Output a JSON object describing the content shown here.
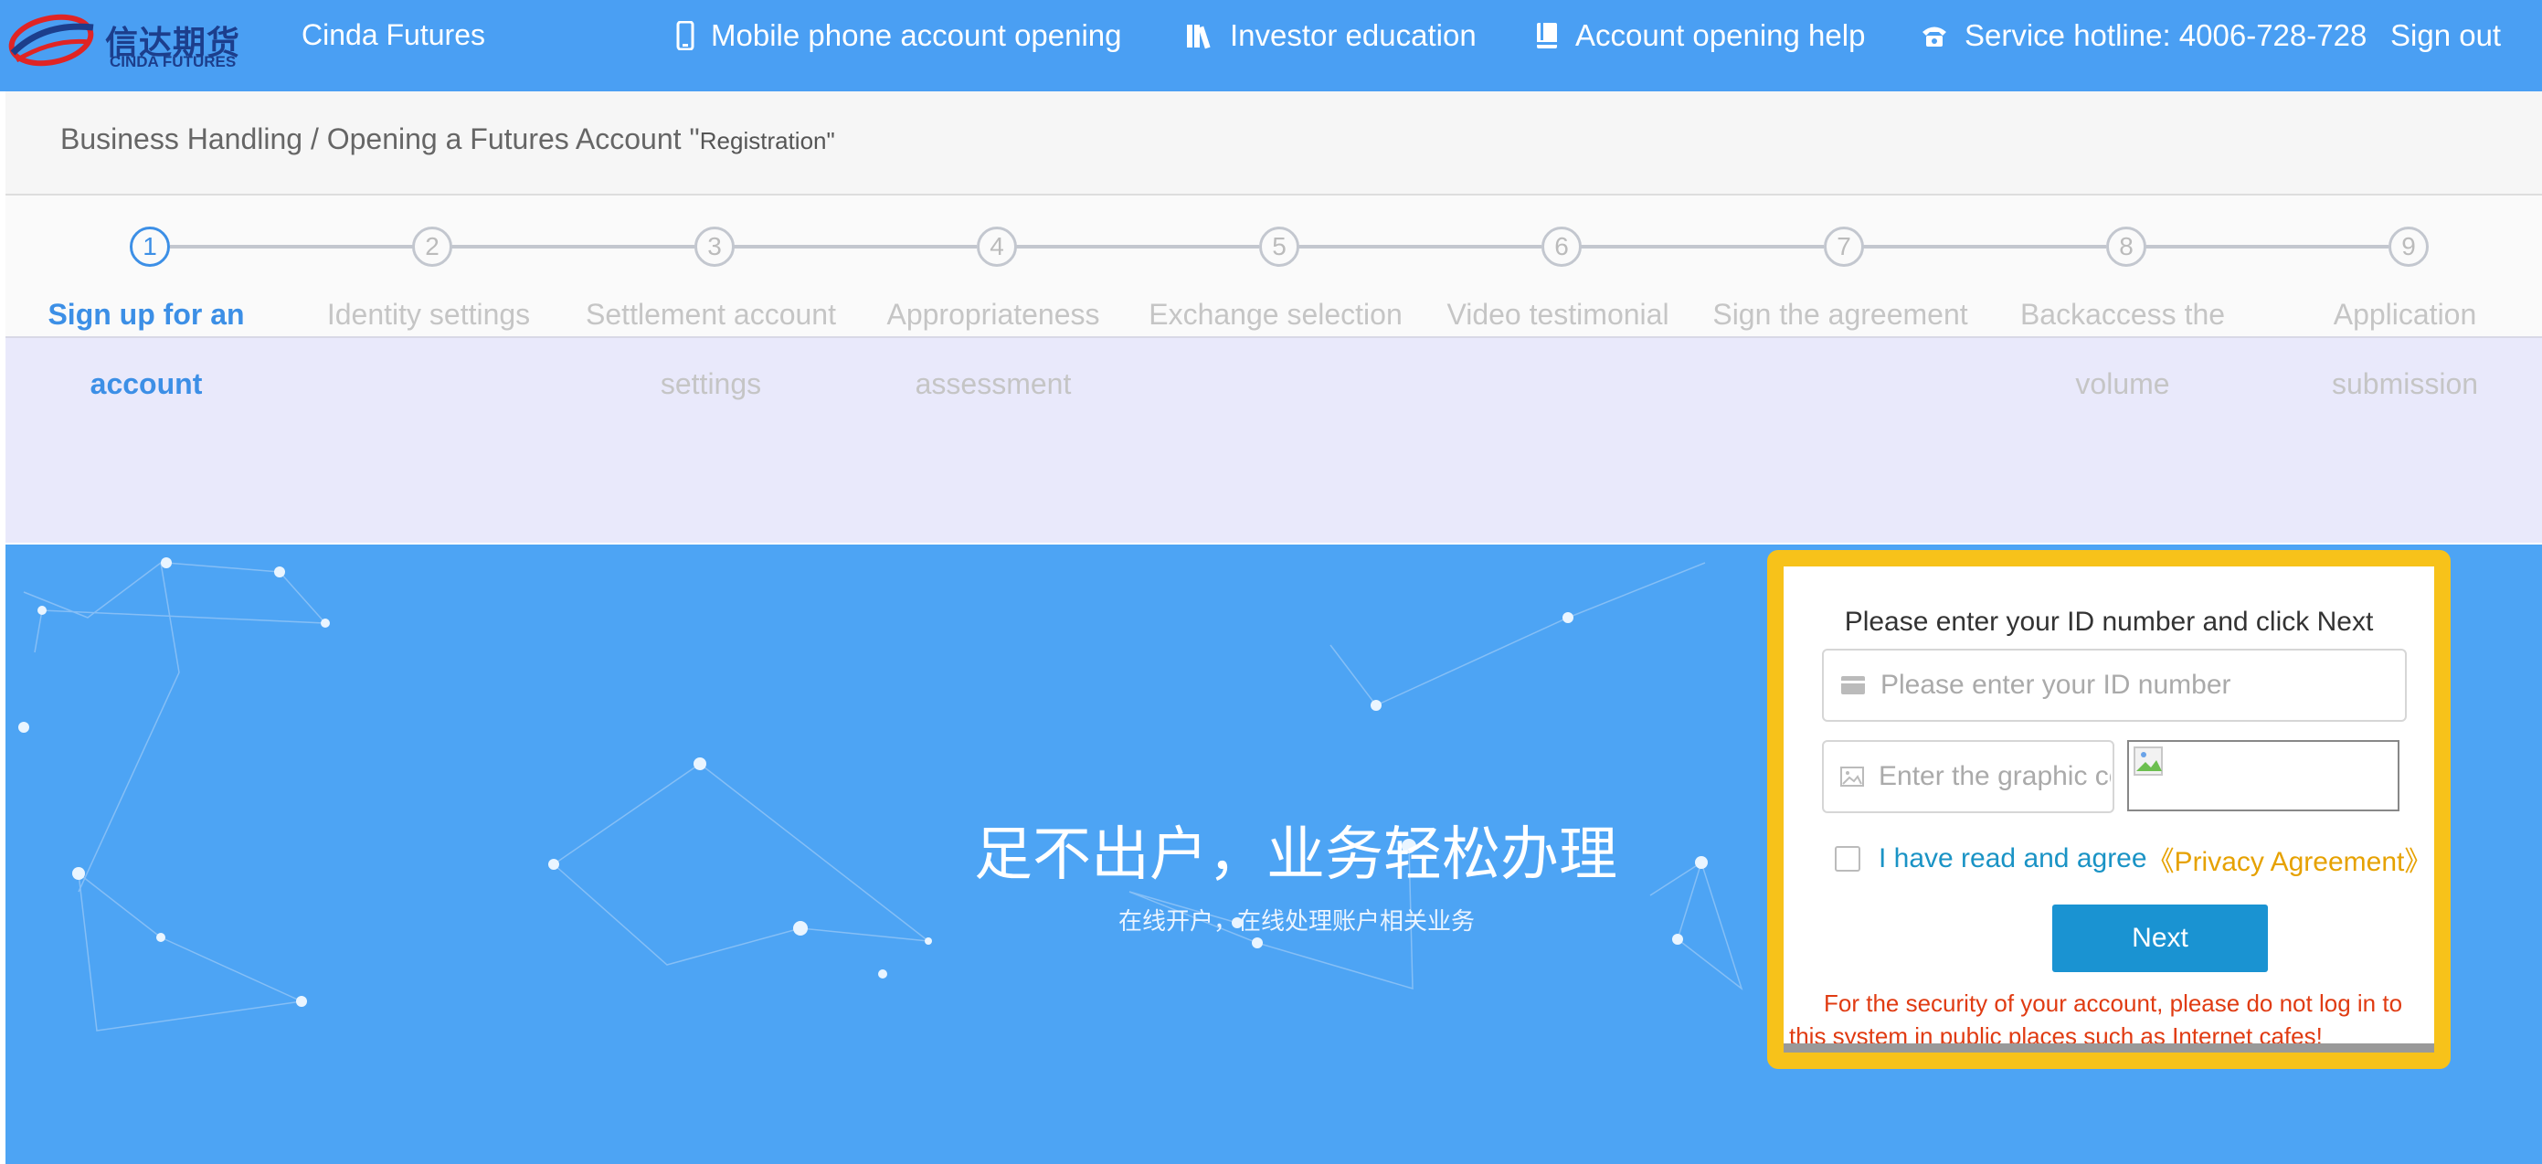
{
  "header": {
    "logo_cn": "信达期货",
    "logo_en": "CINDA FUTURES",
    "brand": "Cinda Futures",
    "nav": [
      {
        "label": "Mobile phone account opening",
        "icon": "mobile-phone-icon"
      },
      {
        "label": "Investor education",
        "icon": "books-icon"
      },
      {
        "label": "Account opening help",
        "icon": "help-book-icon"
      },
      {
        "label": "Service hotline: 4006-728-728",
        "icon": "telephone-icon"
      }
    ],
    "sign_out": "Sign out"
  },
  "breadcrumb": {
    "path": "Business Handling / Opening a Futures Account \"",
    "current": "Registration\""
  },
  "steps": [
    {
      "number": "1",
      "label": "Sign up for an account",
      "active": true
    },
    {
      "number": "2",
      "label": "Identity settings",
      "active": false
    },
    {
      "number": "3",
      "label": "Settlement account settings",
      "active": false
    },
    {
      "number": "4",
      "label": "Appropriateness assessment",
      "active": false
    },
    {
      "number": "5",
      "label": "Exchange selection",
      "active": false
    },
    {
      "number": "6",
      "label": "Video testimonial",
      "active": false
    },
    {
      "number": "7",
      "label": "Sign the agreement",
      "active": false
    },
    {
      "number": "8",
      "label": "Backaccess the volume",
      "active": false
    },
    {
      "number": "9",
      "label": "Application submission",
      "active": false
    }
  ],
  "hero": {
    "title": "足不出户，业务轻松办理",
    "subtitle": "在线开户，在线处理账户相关业务"
  },
  "form": {
    "title": "Please enter your ID number and click Next",
    "id_placeholder": "Please enter your ID number",
    "id_value": "",
    "captcha_placeholder": "Enter the graphic code",
    "captcha_value": "",
    "agree_checked": false,
    "agree_text": "I have read and agree",
    "agree_link": "《Privacy Agreement》",
    "next_label": "Next",
    "warning": "For the security of your account, please do not log in to this system in public places such as Internet cafes!"
  },
  "colors": {
    "topbar": "#4a9ff3",
    "accent": "#3c8fe6",
    "card_border": "#f7c21a",
    "button": "#1a93d2",
    "warning": "#e03b12",
    "link": "#e6a100"
  }
}
